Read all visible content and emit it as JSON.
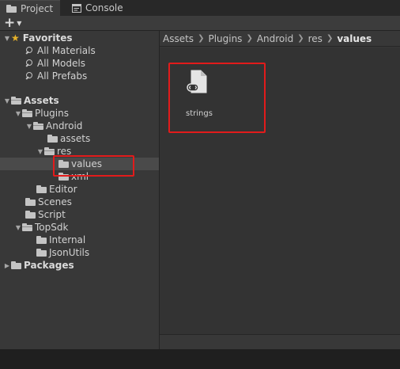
{
  "tabs": [
    {
      "label": "Project",
      "icon": "folder-icon",
      "active": true
    },
    {
      "label": "Console",
      "icon": "console-icon",
      "active": false
    }
  ],
  "toolbar": {
    "add_symbol": "+",
    "add_caret": "▼"
  },
  "tree": {
    "favorites": {
      "label": "Favorites",
      "items": [
        "All Materials",
        "All Models",
        "All Prefabs"
      ]
    },
    "assets": {
      "label": "Assets",
      "plugins": "Plugins",
      "android": "Android",
      "assets_folder": "assets",
      "res": "res",
      "values": "values",
      "xml": "xml",
      "editor": "Editor",
      "scenes": "Scenes",
      "script": "Script",
      "topsdk": "TopSdk",
      "internal": "Internal",
      "jsonutils": "JsonUtils"
    },
    "packages": "Packages"
  },
  "breadcrumb": [
    "Assets",
    "Plugins",
    "Android",
    "res",
    "values"
  ],
  "content": {
    "items": [
      {
        "label": "strings",
        "icon": "xml-file-icon"
      }
    ]
  },
  "colors": {
    "highlight": "#e21b1b",
    "favorite_star": "#e8b32a",
    "selected_row": "#4a4a4a"
  }
}
